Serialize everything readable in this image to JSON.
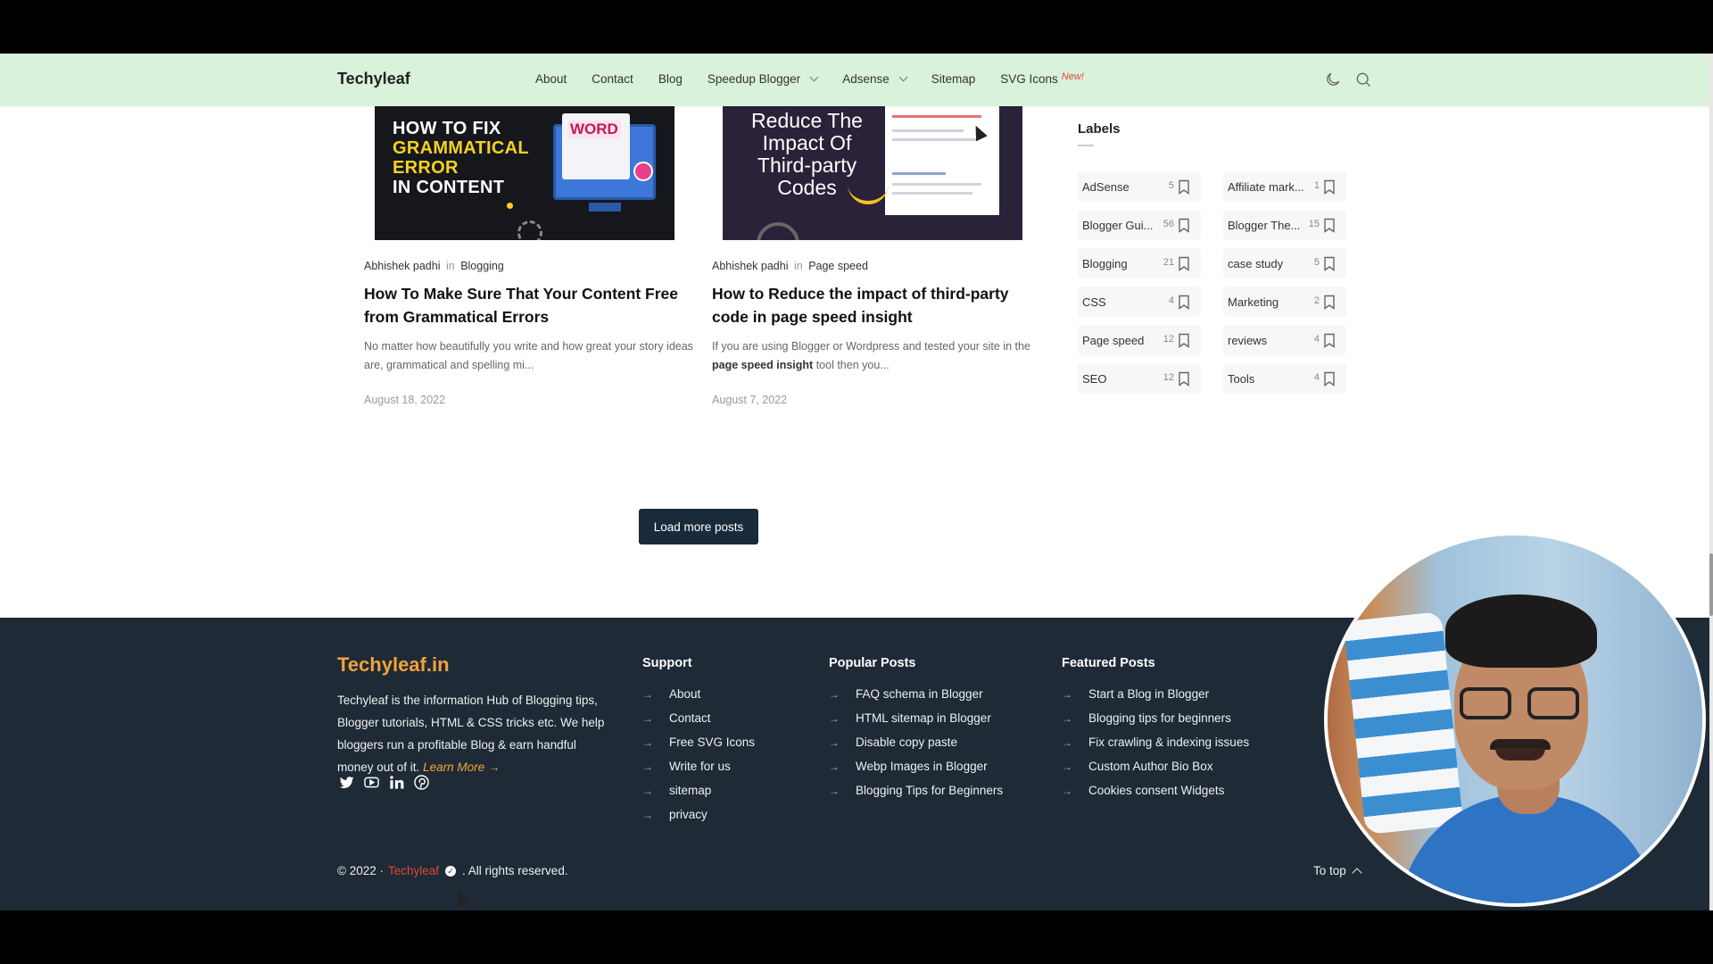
{
  "navbar": {
    "brand": "Techyleaf",
    "links": [
      "About",
      "Contact",
      "Blog",
      "Speedup Blogger",
      "Adsense",
      "Sitemap",
      "SVG Icons"
    ],
    "new_badge": "New!",
    "icons": [
      "moon-icon",
      "search-icon"
    ]
  },
  "posts": [
    {
      "thumb": {
        "line1": "HOW TO FIX",
        "line2": "GRAMMATICAL",
        "line3": "ERROR",
        "line4": "IN CONTENT",
        "word": "WORD"
      },
      "author": "Abhishek padhi",
      "in": "in",
      "category": "Blogging",
      "title": "How To Make Sure That Your Content Free from Grammatical Errors",
      "excerpt": "No matter how beautifully you write and how great your story ideas are, grammatical and spelling mi...",
      "date": "August 18, 2022"
    },
    {
      "thumb": {
        "text": "Reduce The Impact Of Third-party Codes"
      },
      "author": "Abhishek padhi",
      "in": "in",
      "category": "Page speed",
      "title": "How to Reduce the impact of third-party code in page speed insight",
      "excerpt_pre": "If you are using Blogger or Wordpress and tested your site in the ",
      "excerpt_bold": "page speed insight",
      "excerpt_post": " tool then you...",
      "date": "August 7, 2022"
    }
  ],
  "labels": {
    "title": "Labels",
    "items": [
      {
        "name": "AdSense",
        "count": "5"
      },
      {
        "name": "Affiliate mark...",
        "count": "1"
      },
      {
        "name": "Blogger Gui...",
        "count": "56"
      },
      {
        "name": "Blogger The...",
        "count": "15"
      },
      {
        "name": "Blogging",
        "count": "21"
      },
      {
        "name": "case study",
        "count": "5"
      },
      {
        "name": "CSS",
        "count": "4"
      },
      {
        "name": "Marketing",
        "count": "2"
      },
      {
        "name": "Page speed",
        "count": "12"
      },
      {
        "name": "reviews",
        "count": "4"
      },
      {
        "name": "SEO",
        "count": "12"
      },
      {
        "name": "Tools",
        "count": "4"
      }
    ]
  },
  "load_more": "Load more posts",
  "footer": {
    "brand": "Techyleaf.in",
    "description": "Techyleaf is the information Hub of Blogging tips, Blogger tutorials, HTML & CSS tricks etc. We help bloggers run a profitable Blog & earn handful money out of it.",
    "learn_more": "Learn More →",
    "social": [
      "twitter-icon",
      "youtube-icon",
      "linkedin-icon",
      "pinterest-icon"
    ],
    "support": {
      "title": "Support",
      "items": [
        "About",
        "Contact",
        "Free SVG Icons",
        "Write for us",
        "sitemap",
        "privacy"
      ]
    },
    "popular": {
      "title": "Popular Posts",
      "items": [
        "FAQ schema in Blogger",
        "HTML sitemap in Blogger",
        "Disable copy paste",
        "Webp Images in Blogger",
        "Blogging Tips for Beginners"
      ]
    },
    "featured": {
      "title": "Featured Posts",
      "items": [
        "Start a Blog in Blogger",
        "Blogging tips for beginners",
        "Fix crawling & indexing issues",
        "Custom Author Bio Box",
        "Cookies consent Widgets"
      ]
    },
    "copyright_pre": "© 2022 ·",
    "copyright_brand": "Techyleaf",
    "copyright_post": ". All rights reserved.",
    "to_top": "To top"
  },
  "colors": {
    "nav_bg": "#d9f2dc",
    "footer_bg": "#1e2a35",
    "brand_orange": "#f2a33a",
    "accent_red": "#e0463a",
    "button_bg": "#1b2a3a"
  }
}
